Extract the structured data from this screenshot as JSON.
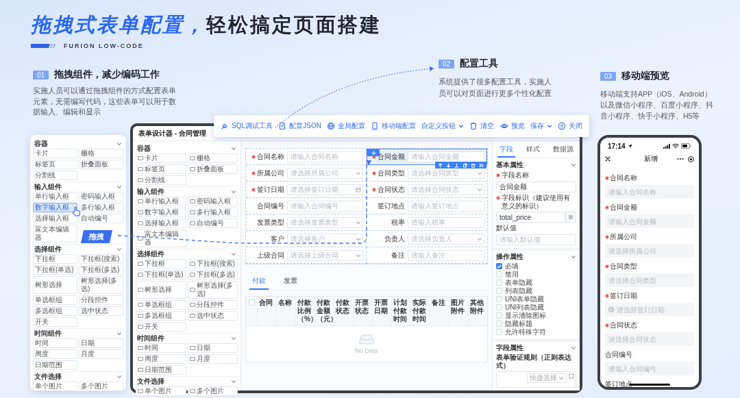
{
  "headline": {
    "accent": "拖拽式表单配置，",
    "rest": "轻松搞定页面搭建"
  },
  "brand": "FURION LOW-CODE",
  "sections": [
    {
      "number": "01",
      "title": "拖拽组件，减少编码工作",
      "description": "实施人员可以通过拖拽组件的方式配置表单元素，无需编写代码，这些表单可以用于数据输入、编辑和显示"
    },
    {
      "number": "02",
      "title": "配置工具",
      "description": "系统提供了很多配置工具，实施人员可以对页面进行更多个性化配置"
    },
    {
      "number": "03",
      "title": "移动端预览",
      "description": "移动端支持APP（iOS、Android）以及微信小程序、百度小程序、抖音小程序、快手小程序、H5等"
    }
  ],
  "drag_tag": "拖拽",
  "component_card": {
    "groups": [
      {
        "title": "容器",
        "expanded": true,
        "items": [
          {
            "label": "卡片",
            "selected": false
          },
          {
            "label": "栅格",
            "selected": false
          },
          {
            "label": "标签页",
            "selected": false
          },
          {
            "label": "折叠面板",
            "selected": false
          },
          {
            "label": "分割线",
            "selected": false
          }
        ]
      },
      {
        "title": "输入组件",
        "expanded": true,
        "items": [
          {
            "label": "单行输入框",
            "selected": false
          },
          {
            "label": "密码输入框",
            "selected": false
          },
          {
            "label": "数字输入框",
            "selected": true
          },
          {
            "label": "多行输入框",
            "selected": false
          },
          {
            "label": "选择输入框",
            "selected": false
          },
          {
            "label": "自动编号",
            "selected": false
          },
          {
            "label": "富文本编辑器",
            "selected": false
          }
        ]
      },
      {
        "title": "选择组件",
        "expanded": true,
        "items": [
          {
            "label": "下拉框",
            "selected": false
          },
          {
            "label": "下拉框(搜索)",
            "selected": false
          },
          {
            "label": "下拉框(单选)",
            "selected": false
          },
          {
            "label": "下拉框(多选)",
            "selected": false
          },
          {
            "label": "树形选择",
            "selected": false
          },
          {
            "label": "树形选择(多选)",
            "selected": false
          },
          {
            "label": "单选框组",
            "selected": false
          },
          {
            "label": "分段控件",
            "selected": false
          },
          {
            "label": "多选框组",
            "selected": false
          },
          {
            "label": "选中状态",
            "selected": false
          },
          {
            "label": "开关",
            "selected": false
          }
        ]
      },
      {
        "title": "时间组件",
        "expanded": true,
        "items": [
          {
            "label": "时间",
            "selected": false
          },
          {
            "label": "日期",
            "selected": false
          },
          {
            "label": "周度",
            "selected": false
          },
          {
            "label": "月度",
            "selected": false
          },
          {
            "label": "日期范围",
            "selected": false
          }
        ]
      },
      {
        "title": "文件选择",
        "expanded": true,
        "items": [
          {
            "label": "单个图片",
            "selected": false
          },
          {
            "label": "多个图片",
            "selected": false
          }
        ]
      }
    ]
  },
  "designer": {
    "title": "表单设计器 - 合同管理",
    "toolbar": [
      {
        "label": "SQL调试工具",
        "dropdown": false
      },
      {
        "label": "配置JSON",
        "dropdown": false
      },
      {
        "label": "全局配置",
        "dropdown": false
      },
      {
        "label": "移动端配置",
        "dropdown": false
      },
      {
        "label": "自定义按钮",
        "dropdown": true
      },
      {
        "label": "清空",
        "dropdown": false
      },
      {
        "label": "预览",
        "dropdown": false
      },
      {
        "label": "保存",
        "dropdown": true
      },
      {
        "label": "关闭",
        "dropdown": false
      }
    ],
    "palette": {
      "groups": [
        {
          "title": "容器",
          "expanded": true,
          "items": [
            {
              "label": "卡片",
              "selected": false
            },
            {
              "label": "栅格",
              "selected": false
            },
            {
              "label": "标签页",
              "selected": false
            },
            {
              "label": "折叠面板",
              "selected": false
            },
            {
              "label": "分割线",
              "selected": false
            }
          ]
        },
        {
          "title": "输入组件",
          "expanded": true,
          "items": [
            {
              "label": "单行输入框",
              "selected": false
            },
            {
              "label": "密码输入框",
              "selected": false
            },
            {
              "label": "数字输入框",
              "selected": false
            },
            {
              "label": "多行输入框",
              "selected": false
            },
            {
              "label": "选择输入框",
              "selected": false
            },
            {
              "label": "自动编号",
              "selected": false
            },
            {
              "label": "富文本编辑器",
              "selected": false
            }
          ]
        },
        {
          "title": "选择组件",
          "expanded": true,
          "items": [
            {
              "label": "下拉框",
              "selected": false
            },
            {
              "label": "下拉框(搜索)",
              "selected": false
            },
            {
              "label": "下拉框(单选)",
              "selected": false
            },
            {
              "label": "下拉框(多选)",
              "selected": false
            },
            {
              "label": "树形选择",
              "selected": false
            },
            {
              "label": "树形选择(多选)",
              "selected": false
            },
            {
              "label": "单选框组",
              "selected": false
            },
            {
              "label": "分段控件",
              "selected": false
            },
            {
              "label": "多选框组",
              "selected": false
            },
            {
              "label": "选中状态",
              "selected": false
            },
            {
              "label": "开关",
              "selected": false
            }
          ]
        },
        {
          "title": "时间组件",
          "expanded": true,
          "items": [
            {
              "label": "时间",
              "selected": false
            },
            {
              "label": "日期",
              "selected": false
            },
            {
              "label": "周度",
              "selected": false
            },
            {
              "label": "月度",
              "selected": false
            },
            {
              "label": "日期范围",
              "selected": false
            }
          ]
        },
        {
          "title": "文件选择",
          "expanded": true,
          "items": [
            {
              "label": "单个图片",
              "selected": false
            },
            {
              "label": "多个图片",
              "selected": false
            }
          ]
        }
      ]
    },
    "form": {
      "rows": [
        [
          {
            "label": "合同名称",
            "required": true,
            "kind": "input",
            "placeholder": "请输入合同名称",
            "selected": false
          },
          {
            "label": "合同金额",
            "required": true,
            "kind": "input",
            "placeholder": "请输入合同金额",
            "selected": true
          }
        ],
        [
          {
            "label": "所属公司",
            "required": true,
            "kind": "select",
            "placeholder": "请选择所属公司",
            "selected": false
          },
          {
            "label": "合同类型",
            "required": true,
            "kind": "select",
            "placeholder": "请选择合同类型",
            "selected": false
          }
        ],
        [
          {
            "label": "签订日期",
            "required": true,
            "kind": "date",
            "placeholder": "请选择签订日期",
            "selected": false
          },
          {
            "label": "合同状态",
            "required": true,
            "kind": "select",
            "placeholder": "请选择合同状态",
            "selected": false
          }
        ],
        [
          {
            "label": "合同编号",
            "required": false,
            "kind": "input",
            "placeholder": "请输入合同编号",
            "selected": false
          },
          {
            "label": "签订地点",
            "required": false,
            "kind": "input",
            "placeholder": "请输入签订地点",
            "selected": false
          }
        ],
        [
          {
            "label": "发票类型",
            "required": false,
            "kind": "select",
            "placeholder": "请选择发票类型",
            "selected": false
          },
          {
            "label": "税率",
            "required": false,
            "kind": "input",
            "placeholder": "请输入税率",
            "selected": false
          }
        ],
        [
          {
            "label": "客户",
            "required": false,
            "kind": "select",
            "placeholder": "请选择客户",
            "selected": false
          },
          {
            "label": "负责人",
            "required": false,
            "kind": "select",
            "placeholder": "请选择负责人",
            "selected": false
          }
        ],
        [
          {
            "label": "上级合同",
            "required": false,
            "kind": "select",
            "placeholder": "请选择上级合同",
            "selected": false
          },
          {
            "label": "备注",
            "required": false,
            "kind": "input",
            "placeholder": "请输入备注",
            "selected": false
          }
        ]
      ]
    },
    "tabs": [
      {
        "label": "付款",
        "selected": true
      },
      {
        "label": "发票",
        "selected": false
      }
    ],
    "table": {
      "all_selected": false,
      "columns": [
        "合同",
        "名称",
        "付款比例（%）",
        "付款金额（元）",
        "付款状态",
        "开票状态",
        "开票日期",
        "计划付款时间",
        "实际付款时间",
        "备注",
        "图片附件",
        "其他附件"
      ],
      "empty_text": "No Data"
    },
    "properties": {
      "tabs": [
        {
          "label": "字段",
          "selected": true
        },
        {
          "label": "样式",
          "selected": false
        },
        {
          "label": "数据源",
          "selected": false
        }
      ],
      "basic": {
        "title": "基本属性",
        "expanded": true,
        "fields": [
          {
            "kind": "text",
            "label": "字段名称",
            "required": true,
            "value": "合同金额"
          },
          {
            "kind": "text-with-button",
            "label": "字段标识（建议使用有意义的标识）",
            "required": true,
            "value": "total_price"
          },
          {
            "kind": "text",
            "label": "默认值",
            "required": false,
            "placeholder": "请输入默认值"
          }
        ]
      },
      "options": {
        "title": "操作属性",
        "expanded": true,
        "checkboxes": [
          {
            "label": "必填",
            "checked": true
          },
          {
            "label": "禁用",
            "checked": false
          },
          {
            "label": "表单隐藏",
            "checked": false
          },
          {
            "label": "列表隐藏",
            "checked": false
          },
          {
            "label": "UNI表单隐藏",
            "checked": false
          },
          {
            "label": "UNI列表隐藏",
            "checked": false
          },
          {
            "label": "显示清除图标",
            "checked": false
          },
          {
            "label": "隐藏标题",
            "checked": false
          },
          {
            "label": "允许特殊字符",
            "checked": false
          }
        ]
      },
      "rules": {
        "title": "字段属性",
        "expanded": true,
        "label": "表单验证规则（正则表达式）",
        "quick_select": "快捷选择"
      }
    }
  },
  "phone": {
    "time": "17:14",
    "title": "新增",
    "fields": [
      {
        "label": "合同名称",
        "required": true,
        "kind": "input",
        "placeholder": "请输入合同名称"
      },
      {
        "label": "合同金额",
        "required": true,
        "kind": "input",
        "placeholder": "请输入合同金额"
      },
      {
        "label": "所属公司",
        "required": true,
        "kind": "input",
        "placeholder": "请选择所属公司"
      },
      {
        "label": "合同类型",
        "required": true,
        "kind": "input",
        "placeholder": "请选择合同类型"
      },
      {
        "label": "签订日期",
        "required": true,
        "kind": "date",
        "placeholder": "请选择签订日期"
      },
      {
        "label": "合同状态",
        "required": true,
        "kind": "input",
        "placeholder": "请选择合同状态"
      },
      {
        "label": "合同编号",
        "required": false,
        "kind": "input",
        "placeholder": "请输入合同编号"
      },
      {
        "label": "签订地点",
        "required": false,
        "kind": "none"
      }
    ]
  }
}
